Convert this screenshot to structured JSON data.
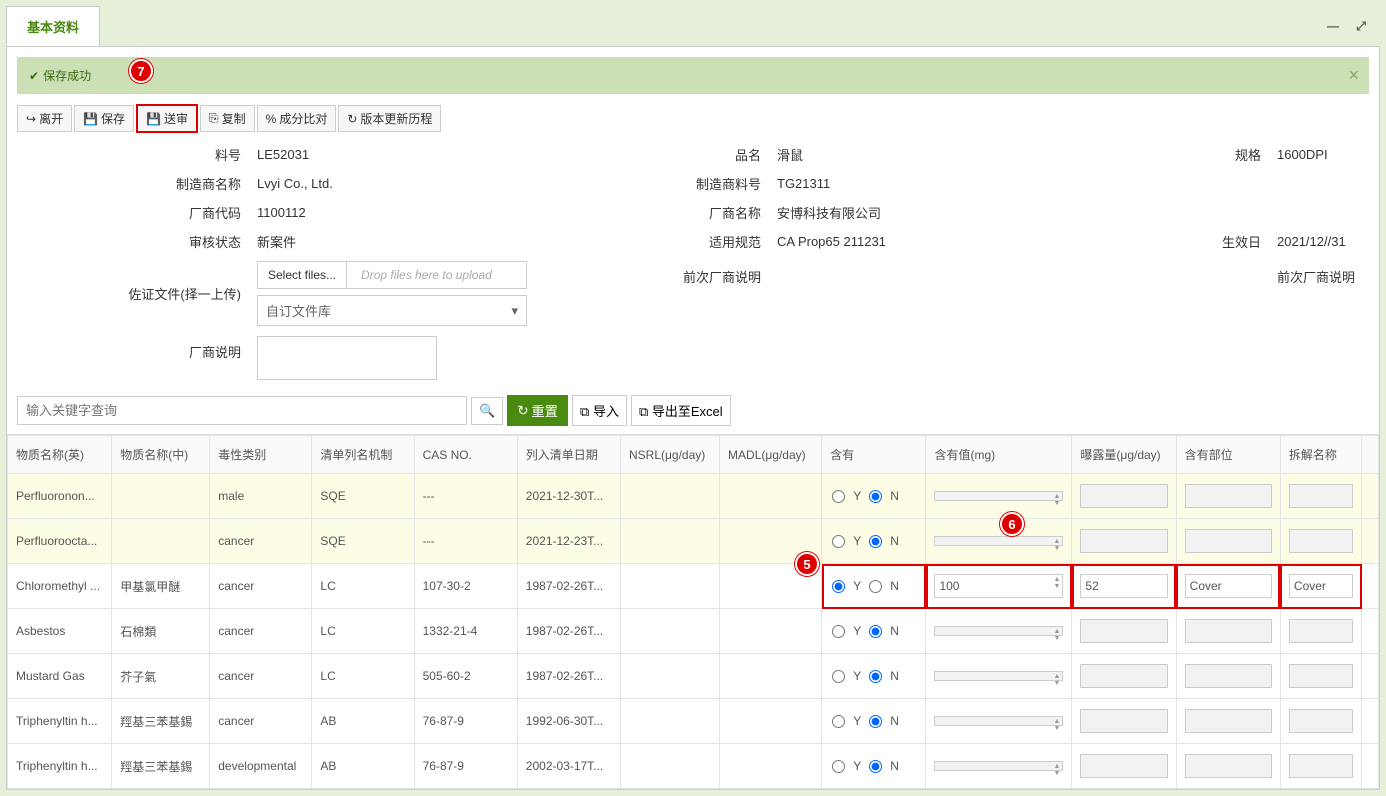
{
  "tab": {
    "label": "基本资料"
  },
  "alert": {
    "text": "保存成功",
    "badge": "7"
  },
  "toolbar": {
    "leave": "离开",
    "save": "保存",
    "submit": "送审",
    "copy": "复制",
    "compare": "成分比对",
    "history": "版本更新历程"
  },
  "info": {
    "partno_lbl": "料号",
    "partno": "LE52031",
    "name_lbl": "品名",
    "name": "滑鼠",
    "spec_lbl": "规格",
    "spec": "1600DPI",
    "mfr_lbl": "制造商名称",
    "mfr": "Lvyi Co., Ltd.",
    "mfrno_lbl": "制造商料号",
    "mfrno": "TG21311",
    "vcode_lbl": "厂商代码",
    "vcode": "1100112",
    "vname_lbl": "厂商名称",
    "vname": "安博科技有限公司",
    "status_lbl": "审核状态",
    "status": "新案件",
    "std_lbl": "适用规范",
    "std": "CA Prop65 211231",
    "eff_lbl": "生效日",
    "eff": "2021/12//31",
    "doc_lbl": "佐证文件(择一上传)",
    "select_files": "Select files...",
    "drop_hint": "Drop files here to upload",
    "custom_lib": "自订文件库",
    "vnote_lbl": "厂商说明",
    "prev_vnote_lbl": "前次厂商说明",
    "prev_vnote_lbl2": "前次厂商说明"
  },
  "search": {
    "placeholder": "输入关键字查询",
    "reset": "重置",
    "import": "导入",
    "export": "导出至Excel"
  },
  "cols": {
    "en": "物质名称(英)",
    "cn": "物质名称(中)",
    "tox": "毒性类别",
    "mech": "清单列名机制",
    "cas": "CAS NO.",
    "date": "列入清单日期",
    "nsrl": "NSRL(μg/day)",
    "madl": "MADL(μg/day)",
    "has": "含有",
    "hasval": "含有值(mg)",
    "exp": "曝露量(μg/day)",
    "part": "含有部位",
    "dis": "拆解名称"
  },
  "badges": {
    "row": "5",
    "val": "6"
  },
  "rows": [
    {
      "en": "Perfluoronon...",
      "cn": "",
      "tox": "male",
      "mech": "SQE",
      "cas": "---",
      "date": "2021-12-30T...",
      "hasY": false,
      "hl": true
    },
    {
      "en": "Perfluoroocta...",
      "cn": "",
      "tox": "cancer",
      "mech": "SQE",
      "cas": "---",
      "date": "2021-12-23T...",
      "hasY": false,
      "hl": true
    },
    {
      "en": "Chloromethyl ...",
      "cn": "甲基氯甲醚",
      "tox": "cancer",
      "mech": "LC",
      "cas": "107-30-2",
      "date": "1987-02-26T...",
      "hasY": true,
      "active": true,
      "val": "100",
      "exp": "52",
      "part": "Cover",
      "dis": "Cover"
    },
    {
      "en": "Asbestos",
      "cn": "石棉類",
      "tox": "cancer",
      "mech": "LC",
      "cas": "1332-21-4",
      "date": "1987-02-26T...",
      "hasY": false
    },
    {
      "en": "Mustard Gas",
      "cn": "芥子氣",
      "tox": "cancer",
      "mech": "LC",
      "cas": "505-60-2",
      "date": "1987-02-26T...",
      "hasY": false
    },
    {
      "en": "Triphenyltin h...",
      "cn": "羥基三苯基錫",
      "tox": "cancer",
      "mech": "AB",
      "cas": "76-87-9",
      "date": "1992-06-30T...",
      "hasY": false
    },
    {
      "en": "Triphenyltin h...",
      "cn": "羥基三苯基錫",
      "tox": "developmental",
      "mech": "AB",
      "cas": "76-87-9",
      "date": "2002-03-17T...",
      "hasY": false
    }
  ]
}
